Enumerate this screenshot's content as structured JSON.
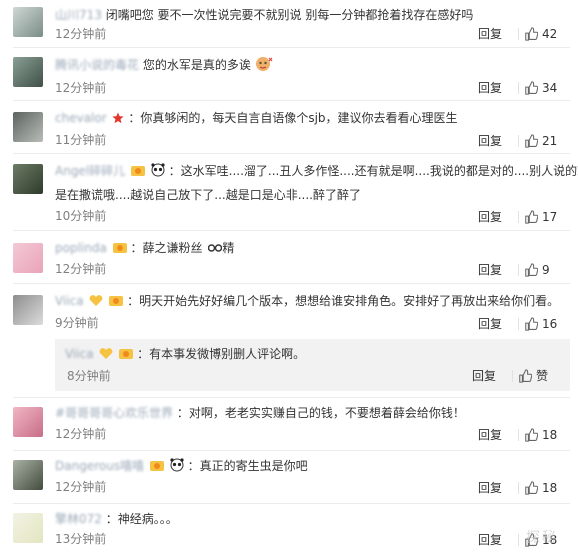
{
  "comments": [
    {
      "user": "山川713",
      "text": "闭嘴吧您  要不一次性说完要不就别说 别每一分钟都抢着找存在感好吗",
      "time": "12分钟前",
      "reply": "回复",
      "likes": "42"
    },
    {
      "user": "腾讯小说的毒花",
      "text": "您的水军是真的多诶",
      "time": "12分钟前",
      "reply": "回复",
      "likes": "34"
    },
    {
      "user": "chevalor",
      "text": "：你真够闲的，每天自言自语像个sjb，建议你去看看心理医生",
      "time": "11分钟前",
      "reply": "回复",
      "likes": "21"
    },
    {
      "user": "Angel碎碎儿",
      "text": "：这水军哇....溜了...丑人多作怪....还有就是啊....我说的都是对的....别人说的就",
      "text2": "是在撒谎哦....越说自己放下了...越是口是心非....醉了醉了",
      "time": "10分钟前",
      "reply": "回复",
      "likes": "17"
    },
    {
      "user": "poplinda",
      "text": "：薛之谦粉丝",
      "text_tail": "精",
      "time": "12分钟前",
      "reply": "回复",
      "likes": "9"
    },
    {
      "user": "Viica",
      "text": "：明天开始先好好编几个版本，想想给谁安排角色。安排好了再放出来给你们看。",
      "time": "9分钟前",
      "reply": "回复",
      "likes": "16",
      "subreply": {
        "user": "Viica",
        "text": "：有本事发微博别删人评论啊。",
        "time": "8分钟前",
        "reply": "回复",
        "likes": "赞"
      }
    },
    {
      "user": "#哥哥哥哥心欢乐世界",
      "text": "：对啊，老老实实赚自己的钱，不要想着薛会给你钱！",
      "time": "12分钟前",
      "reply": "回复",
      "likes": "18"
    },
    {
      "user": "Dangerous嘻嘻",
      "text": "：真正的寄生虫是你吧",
      "time": "12分钟前",
      "reply": "回复",
      "likes": "18"
    },
    {
      "user": "擎林072",
      "text": "：神经病。。。",
      "time": "13分钟前",
      "reply": "回复",
      "likes": "18"
    }
  ],
  "watermark": "探秘",
  "colors": {
    "link": "#9aa8b8",
    "text": "#333333",
    "time": "#808080",
    "subreply_bg": "#f2f2f2",
    "accent": "#eb7350"
  }
}
